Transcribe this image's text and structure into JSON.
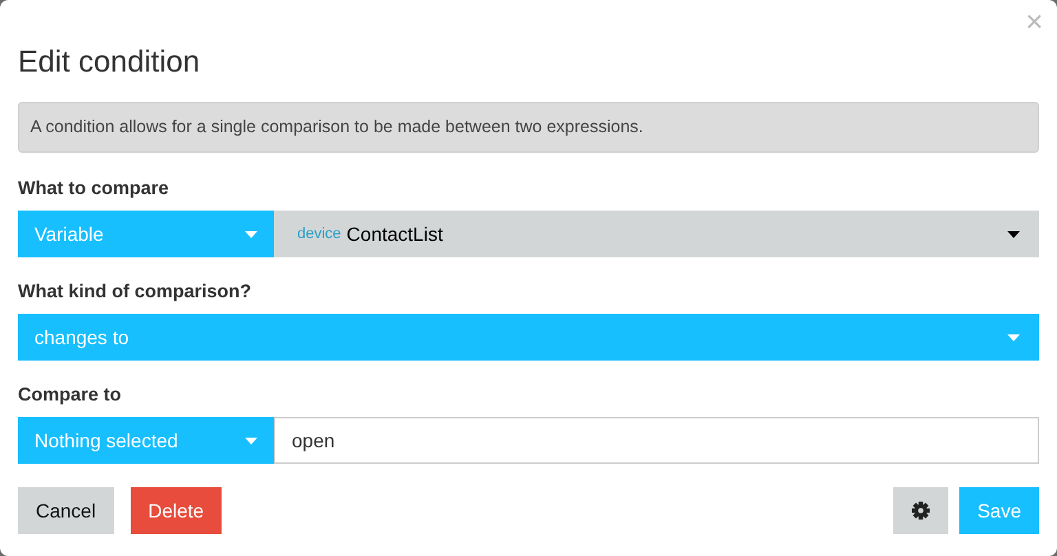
{
  "dialog": {
    "title": "Edit condition",
    "close": "×"
  },
  "info": "A condition allows for a single comparison to be made between two expressions.",
  "sections": [
    {
      "kind": "pair",
      "label": "What to compare",
      "select": "Variable",
      "target": {
        "kind": "select",
        "tag": "device",
        "value": "ContactList"
      }
    },
    {
      "kind": "single",
      "label": "What kind of comparison?",
      "select": "changes to"
    },
    {
      "kind": "pair",
      "label": "Compare to",
      "select": "Nothing selected",
      "target": {
        "kind": "input",
        "value": "open"
      }
    }
  ],
  "buttons": [
    {
      "label": "Cancel",
      "kind": "default"
    },
    {
      "label": "Delete",
      "kind": "danger"
    },
    {
      "kind": "settings"
    },
    {
      "label": "Save",
      "kind": "primary"
    }
  ]
}
